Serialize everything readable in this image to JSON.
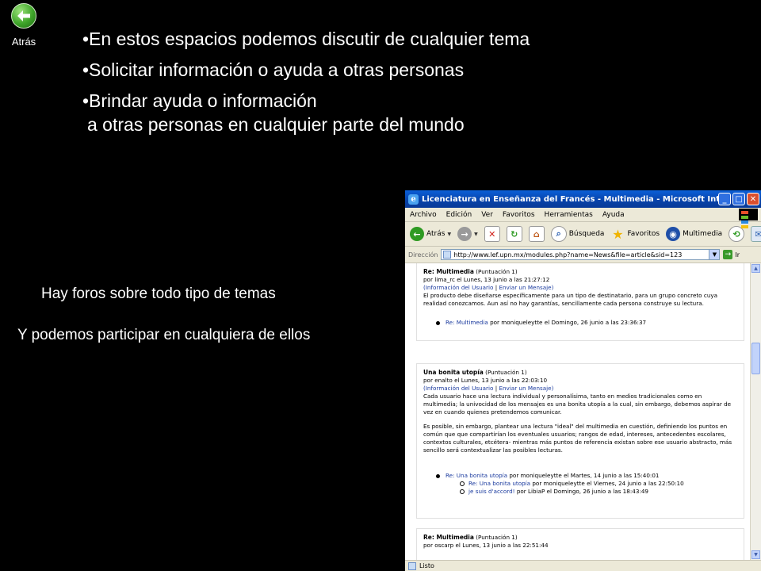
{
  "slide": {
    "back_label": "Atrás",
    "bullets": [
      "•En estos espacios podemos discutir de cualquier tema",
      "•Solicitar información o ayuda a otras personas",
      "•Brindar ayuda o información"
    ],
    "bullet3_cont": "a otras personas en cualquier parte del mundo",
    "side_1": "Hay foros sobre todo tipo de temas",
    "side_2": "Y podemos participar en cualquiera de ellos"
  },
  "ie": {
    "title": "Licenciatura en Enseñanza del Francés - Multimedia - Microsoft Internet Explorer",
    "menu": [
      "Archivo",
      "Edición",
      "Ver",
      "Favoritos",
      "Herramientas",
      "Ayuda"
    ],
    "toolbar": {
      "back": "Atrás",
      "search": "Búsqueda",
      "favorites": "Favoritos",
      "multimedia": "Multimedia"
    },
    "address_label": "Dirección",
    "address": "http://www.lef.upn.mx/modules.php?name=News&file=article&sid=123",
    "go": "Ir",
    "status": "Listo"
  },
  "posts": {
    "p1": {
      "title": "Re: Multimedia",
      "score": "(Puntuación 1)",
      "meta": "por lima_rc el Lunes, 13 junio a las 21:27:12",
      "info_link": "(Información del Usuario",
      "sep": "|",
      "msg_link": "Enviar un Mensaje)",
      "body": "El producto debe diseñarse específicamente para un tipo de destinatario, para un grupo concreto cuya realidad conozcamos. Aun así no hay garantías, sencillamente cada persona construye su lectura.",
      "reply_link": "Re: Multimedia",
      "reply_meta": "por moniqueleytte el Domingo, 26 junio a las 23:36:37"
    },
    "p2": {
      "title": "Una bonita utopía",
      "score": "(Puntuación 1)",
      "meta": "por enalto el Lunes, 13 junio a las 22:03:10",
      "info_link": "(Información del Usuario",
      "sep": "|",
      "msg_link": "Enviar un Mensaje)",
      "body1": "Cada usuario hace una lectura individual y personalísima, tanto en medios tradicionales como en multimedia; la univocidad de los mensajes es una bonita utopía a la cual, sin embargo, debemos aspirar de vez en cuando quienes pretendemos comunicar.",
      "body2": "Es posible, sin embargo, plantear una lectura \"ideal\" del multimedia en cuestión, definiendo los puntos en común que que compartirían los eventuales usuarios; rangos de edad, intereses, antecedentes escolares, contextos culturales, etcétera- mientras más puntos de referencia existan sobre ese usuario abstracto, más sencillo será contextualizar las posibles lecturas.",
      "replies": [
        {
          "link": "Re: Una bonita utopía",
          "meta": "por moniqueleytte el Martes, 14 junio a las 15:40:01"
        },
        {
          "link": "Re: Una bonita utopía",
          "meta": "por moniqueleytte el Viernes, 24 junio a las 22:50:10"
        },
        {
          "link": "je suis d'accord!",
          "meta": "por LibiaP el Domingo, 26 junio a las 18:43:49"
        }
      ]
    },
    "p3": {
      "title": "Re: Multimedia",
      "score": "(Puntuación 1)",
      "meta": "por oscarp el Lunes, 13 junio a las 22:51:44"
    }
  }
}
